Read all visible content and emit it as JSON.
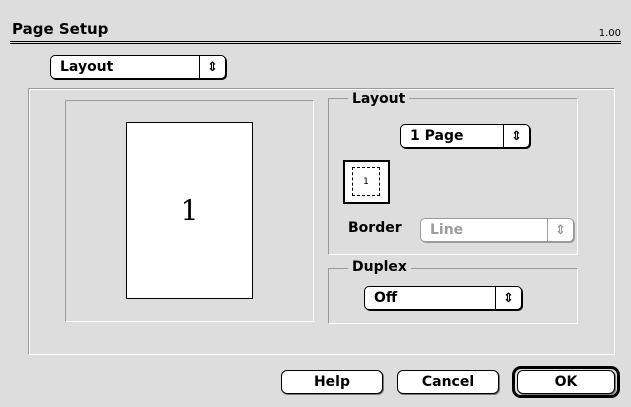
{
  "dialog": {
    "title": "Page Setup",
    "version": "1.00"
  },
  "panel_selector": {
    "value": "Layout",
    "arrow": "⇕"
  },
  "preview": {
    "page_number": "1"
  },
  "layout_group": {
    "legend": "Layout",
    "pages_per_sheet": "1 Page",
    "layout_icon_number": "1",
    "border_label": "Border",
    "border_value": "Line"
  },
  "duplex_group": {
    "legend": "Duplex",
    "value": "Off"
  },
  "buttons": {
    "help": "Help",
    "cancel": "Cancel",
    "ok": "OK"
  },
  "icons": {
    "popup_arrow": "up-down-arrows-icon"
  }
}
